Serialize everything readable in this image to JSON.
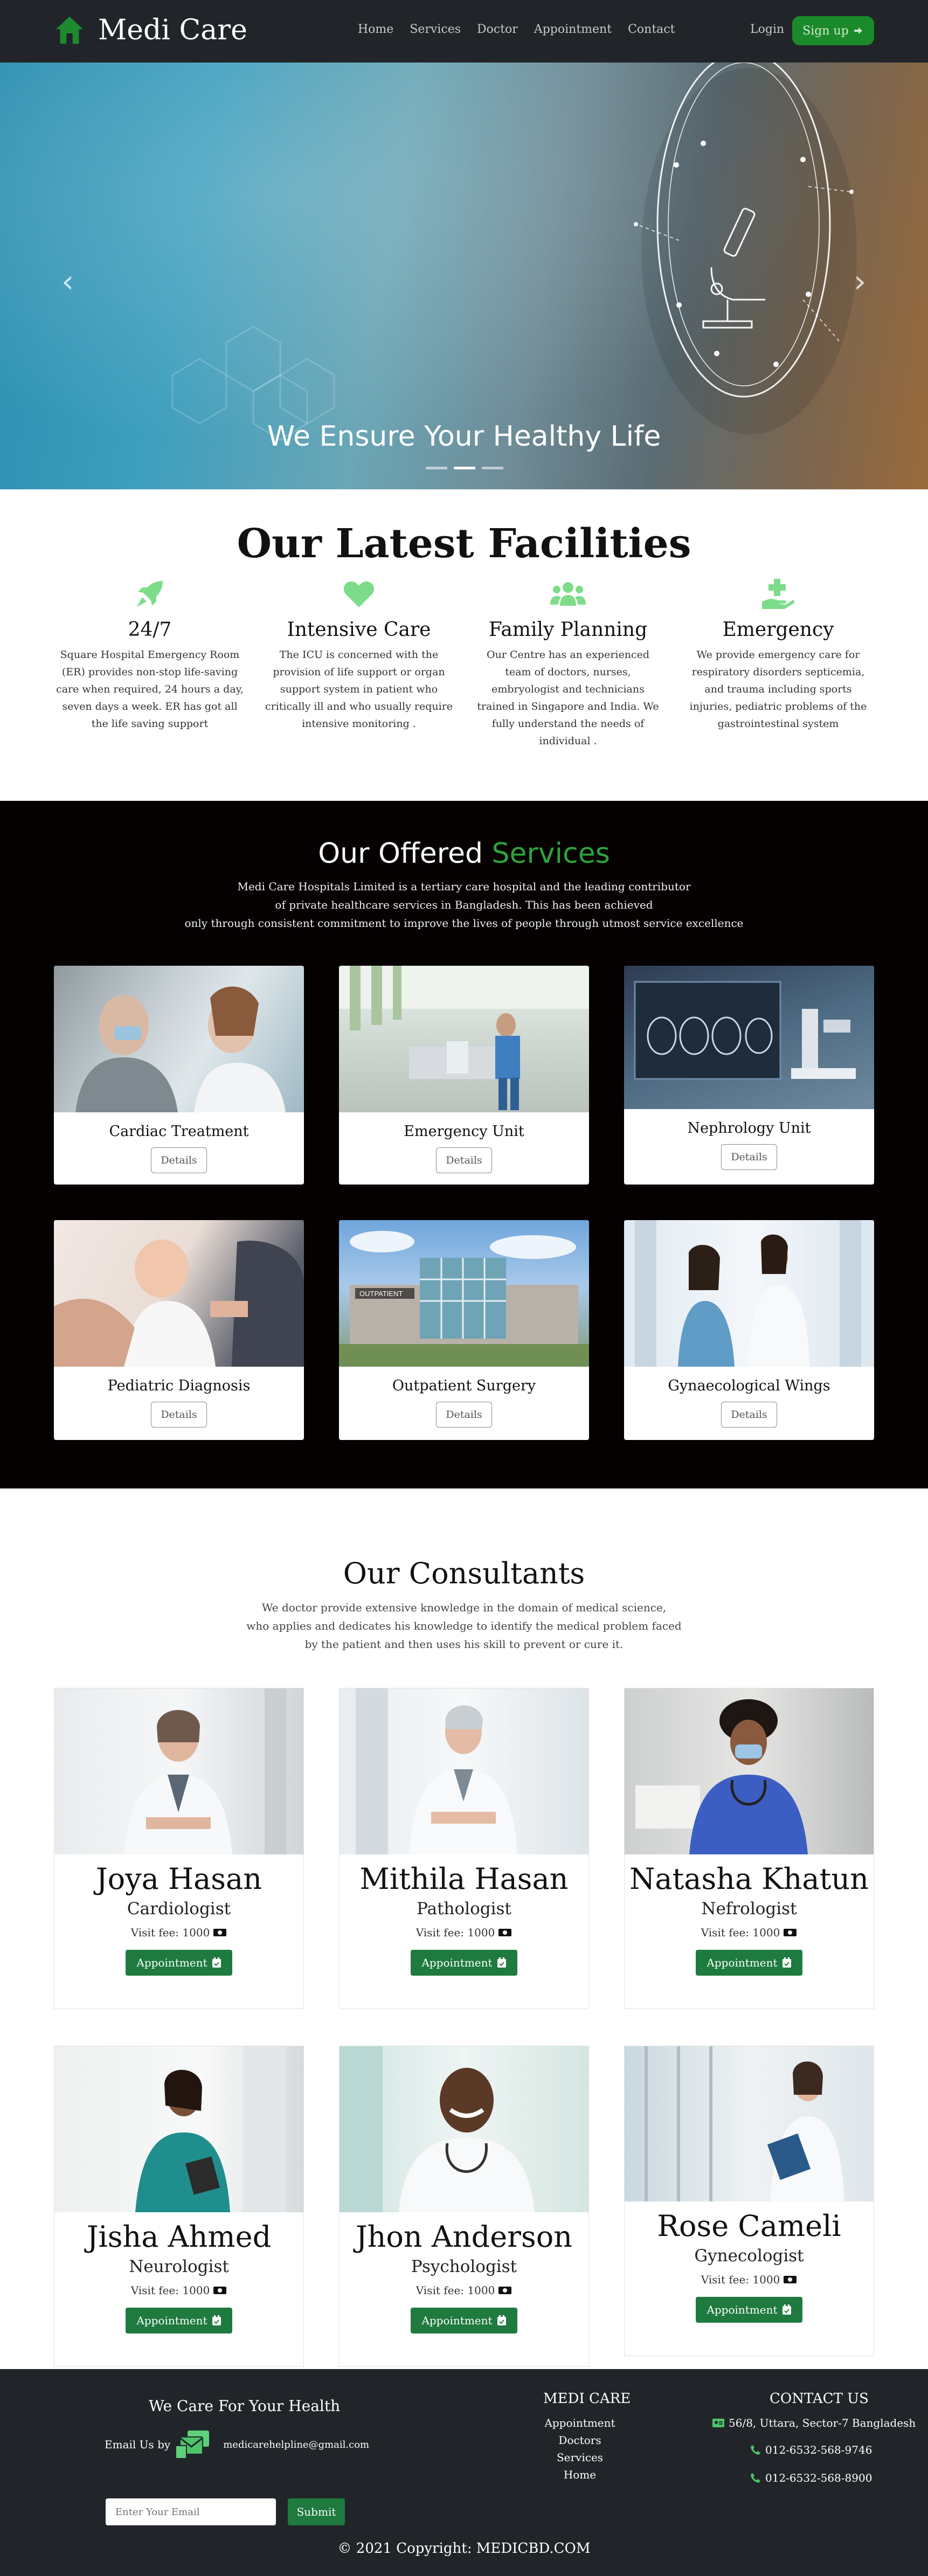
{
  "nav": {
    "brand": "Medi Care",
    "links": [
      "Home",
      "Services",
      "Doctor",
      "Appointment",
      "Contact"
    ],
    "login": "Login",
    "signup": "Sign up"
  },
  "hero": {
    "title": "We Ensure Your Healthy Life",
    "prev_arrow": "‹",
    "next_arrow": "›",
    "slides": 3,
    "active_slide": 2
  },
  "facilities": {
    "title": "Our Latest Facilities",
    "items": [
      {
        "icon": "rocket-icon",
        "title": "24/7",
        "text": "Square Hospital Emergency Room (ER) provides non-stop life-saving care when required, 24 hours a day, seven days a week. ER has got all the life saving support"
      },
      {
        "icon": "heart-icon",
        "title": "Intensive Care",
        "text": "The ICU is concerned with the provision of life support or organ support system in patient who critically ill and who usually require intensive monitoring ."
      },
      {
        "icon": "users-icon",
        "title": "Family Planning",
        "text": "Our Centre has an experienced team of doctors, nurses, embryologist and technicians trained in Singapore and India. We fully understand the needs of individual ."
      },
      {
        "icon": "hand-holding-medical-icon",
        "title": "Emergency",
        "text": "We provide emergency care for respiratory disorders septicemia, and trauma including sports injuries, pediatric problems of the gastrointestinal system"
      }
    ],
    "icon_color": "#7ddc8a"
  },
  "services": {
    "title_part1": "Our Offered",
    "title_part2": "Services",
    "accent": "#2aa53c",
    "desc_lines": [
      "Medi Care Hospitals Limited is a tertiary care hospital and the leading contributor",
      "of private healthcare services in Bangladesh. This has been achieved",
      "only through consistent commitment to improve the lives of people through utmost service excellence"
    ],
    "details_label": "Details",
    "items": [
      {
        "name": "Cardiac Treatment"
      },
      {
        "name": "Emergency Unit"
      },
      {
        "name": "Nephrology Unit"
      },
      {
        "name": "Pediatric Diagnosis"
      },
      {
        "name": "Outpatient Surgery"
      },
      {
        "name": "Gynaecological Wings"
      }
    ],
    "building_sign": "OUTPATIENT"
  },
  "consultants": {
    "title": "Our Consultants",
    "desc_lines": [
      "We doctor provide extensive knowledge in the domain of medical science,",
      "who applies and dedicates his knowledge to identify the medical problem faced",
      "by the patient and then uses his skill to prevent or cure it."
    ],
    "fee_label": "Visit fee: 1000",
    "appointment_label": "Appointment",
    "doctors": [
      {
        "name": "Joya Hasan",
        "specialty": "Cardiologist"
      },
      {
        "name": "Mithila Hasan",
        "specialty": "Pathologist"
      },
      {
        "name": "Natasha Khatun",
        "specialty": "Nefrologist"
      },
      {
        "name": "Jisha Ahmed",
        "specialty": "Neurologist"
      },
      {
        "name": "Jhon Anderson",
        "specialty": "Psychologist"
      },
      {
        "name": "Rose Cameli",
        "specialty": "Gynecologist"
      }
    ]
  },
  "footer": {
    "tagline": "We Care For Your Health",
    "email_label": "Email Us by",
    "email": "medicarehelpline@gmail.com",
    "medi_title": "MEDI CARE",
    "links": [
      "Appointment",
      "Doctors",
      "Services",
      "Home"
    ],
    "contact_title": "CONTACT US",
    "address": "56/8, Uttara, Sector-7 Bangladesh",
    "phones": [
      "012-6532-568-9746",
      "012-6532-568-8900"
    ],
    "email_placeholder": "Enter Your Email",
    "submit": "Submit",
    "copyright": "© 2021 Copyright: MEDICBD.COM"
  }
}
